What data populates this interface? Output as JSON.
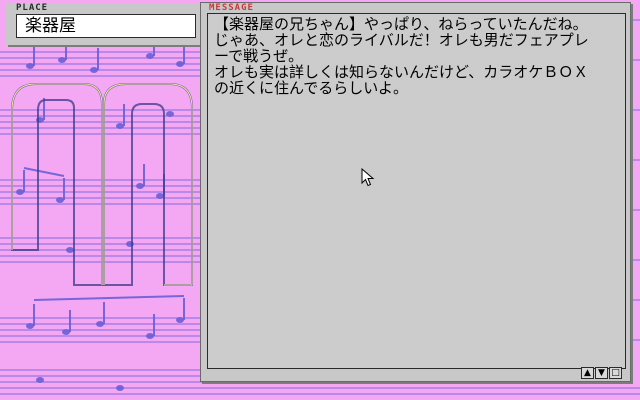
{
  "place": {
    "caption": "PLACE",
    "value": "楽器屋"
  },
  "message": {
    "caption": "MESSAGE",
    "lines": [
      "【楽器屋の兄ちゃん】やっぱり、ねらっていたんだね。",
      "じゃあ、オレと恋のライバルだ！オレも男だフェアプレ",
      "ーで戦うぜ。",
      "オレも実は詳しくは知らないんだけど、カラオケＢＯＸ",
      "の近くに住んでるらしいよ。"
    ]
  },
  "scroll_buttons": {
    "up": "▲",
    "down": "▼",
    "close": "□"
  },
  "colors": {
    "background": "#f4a8f4",
    "score_ink": "#6a5fd8",
    "window_gray": "#c8c8c8",
    "message_caption": "#c83a3a"
  },
  "icons": [
    "mouse-pointer-icon"
  ]
}
